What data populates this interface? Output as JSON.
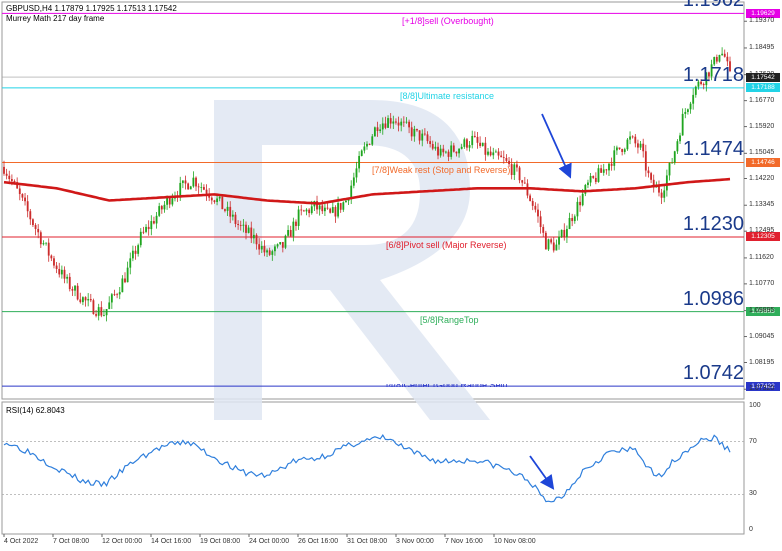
{
  "header": {
    "symbol_line": "GBPUSD,H4  1.17879 1.17925 1.17513 1.17542",
    "indicator_line": "Murrey Math 217 day frame",
    "rsi_label": "RSI(14) 62.8043"
  },
  "colors": {
    "candle_up": "#1fa51f",
    "candle_down": "#cc2b2b",
    "ma": "#d01818",
    "rsi_line": "#2f7fdc",
    "arrow": "#1e46d8",
    "big_label": "#1a3a8a"
  },
  "levels": [
    {
      "id": "l1",
      "price": 1.19629,
      "big": "1.1962",
      "label": "[+1/8]sell (Overbought)",
      "tag": "1.19629",
      "color": "#e600e6"
    },
    {
      "id": "l2",
      "price": 1.17188,
      "big": "1.1718",
      "label": "[8/8]Ultimate resistance",
      "tag": "1.17188",
      "color": "#22d3e6"
    },
    {
      "id": "l3",
      "price": 1.14746,
      "big": "1.1474",
      "label": "[7/8]Weak rest (Stop and Reverse)",
      "tag": "1.14746",
      "color": "#f26a2a"
    },
    {
      "id": "l4",
      "price": 1.12305,
      "big": "1.1230",
      "label": "[6/8]Pivot sell (Major Reverse)",
      "tag": "1.12305",
      "color": "#e0202e"
    },
    {
      "id": "l5",
      "price": 1.09863,
      "big": "1.0986",
      "label": "[5/8]RangeTop",
      "tag": "1.09863",
      "color": "#2fae5a"
    },
    {
      "id": "l6",
      "price": 1.07422,
      "big": "1.0742",
      "label": "[4/8]Center (Good Range Sell)",
      "tag": "1.07422",
      "color": "#2a36c8"
    }
  ],
  "price_axis": {
    "ticks": [
      "1.19370",
      "1.18495",
      "1.17620",
      "1.16770",
      "1.15920",
      "1.15045",
      "1.14220",
      "1.13345",
      "1.12495",
      "1.11620",
      "1.10770",
      "1.09895",
      "1.09045",
      "1.08195",
      "1.07320"
    ],
    "current_price": "1.17542"
  },
  "rsi_axis": {
    "ticks": [
      "100",
      "70",
      "30",
      "0"
    ],
    "levels": [
      70,
      30
    ]
  },
  "time_axis": {
    "ticks": [
      "4 Oct 2022",
      "7 Oct 08:00",
      "12 Oct 00:00",
      "14 Oct 16:00",
      "19 Oct 08:00",
      "24 Oct 00:00",
      "26 Oct 16:00",
      "31 Oct 08:00",
      "3 Nov 00:00",
      "7 Nov 16:00",
      "10 Nov 08:00"
    ]
  },
  "chart_data": {
    "type": "candlestick",
    "symbol": "GBPUSD",
    "timeframe": "H4",
    "ylim": [
      1.07,
      1.2
    ],
    "rsi_ylim": [
      0,
      100
    ],
    "knots": [
      [
        0,
        1.146
      ],
      [
        5,
        1.138
      ],
      [
        12,
        1.126
      ],
      [
        18,
        1.116
      ],
      [
        24,
        1.108
      ],
      [
        32,
        1.101
      ],
      [
        38,
        1.098
      ],
      [
        46,
        1.11
      ],
      [
        52,
        1.123
      ],
      [
        58,
        1.13
      ],
      [
        64,
        1.137
      ],
      [
        72,
        1.142
      ],
      [
        80,
        1.136
      ],
      [
        86,
        1.13
      ],
      [
        90,
        1.126
      ],
      [
        96,
        1.122
      ],
      [
        100,
        1.117
      ],
      [
        106,
        1.12
      ],
      [
        112,
        1.13
      ],
      [
        118,
        1.133
      ],
      [
        124,
        1.13
      ],
      [
        130,
        1.135
      ],
      [
        136,
        1.15
      ],
      [
        142,
        1.16
      ],
      [
        148,
        1.162
      ],
      [
        154,
        1.158
      ],
      [
        160,
        1.155
      ],
      [
        166,
        1.15
      ],
      [
        172,
        1.152
      ],
      [
        178,
        1.155
      ],
      [
        184,
        1.15
      ],
      [
        190,
        1.148
      ],
      [
        196,
        1.143
      ],
      [
        202,
        1.132
      ],
      [
        206,
        1.121
      ],
      [
        210,
        1.12
      ],
      [
        216,
        1.13
      ],
      [
        222,
        1.14
      ],
      [
        228,
        1.145
      ],
      [
        234,
        1.152
      ],
      [
        238,
        1.155
      ],
      [
        242,
        1.152
      ],
      [
        246,
        1.14
      ],
      [
        250,
        1.138
      ],
      [
        254,
        1.148
      ],
      [
        258,
        1.162
      ],
      [
        262,
        1.171
      ],
      [
        266,
        1.175
      ],
      [
        270,
        1.18
      ],
      [
        272,
        1.184
      ],
      [
        274,
        1.182
      ],
      [
        276,
        1.1754
      ]
    ],
    "ma217_knots": [
      [
        0,
        1.141
      ],
      [
        20,
        1.139
      ],
      [
        40,
        1.135
      ],
      [
        60,
        1.136
      ],
      [
        80,
        1.137
      ],
      [
        100,
        1.135
      ],
      [
        120,
        1.134
      ],
      [
        140,
        1.137
      ],
      [
        160,
        1.138
      ],
      [
        180,
        1.139
      ],
      [
        200,
        1.139
      ],
      [
        220,
        1.138
      ],
      [
        240,
        1.139
      ],
      [
        260,
        1.141
      ],
      [
        276,
        1.142
      ]
    ],
    "rsi_knots": [
      [
        0,
        70
      ],
      [
        10,
        62
      ],
      [
        20,
        50
      ],
      [
        30,
        40
      ],
      [
        38,
        37
      ],
      [
        50,
        56
      ],
      [
        60,
        66
      ],
      [
        70,
        70
      ],
      [
        80,
        58
      ],
      [
        90,
        47
      ],
      [
        100,
        44
      ],
      [
        110,
        55
      ],
      [
        120,
        58
      ],
      [
        135,
        70
      ],
      [
        145,
        73
      ],
      [
        155,
        62
      ],
      [
        165,
        55
      ],
      [
        180,
        56
      ],
      [
        190,
        50
      ],
      [
        200,
        40
      ],
      [
        206,
        24
      ],
      [
        212,
        28
      ],
      [
        220,
        48
      ],
      [
        230,
        62
      ],
      [
        240,
        64
      ],
      [
        248,
        42
      ],
      [
        256,
        58
      ],
      [
        264,
        70
      ],
      [
        270,
        73
      ],
      [
        276,
        62.8
      ]
    ],
    "forecast": {
      "price": "down",
      "rsi": "down"
    }
  }
}
